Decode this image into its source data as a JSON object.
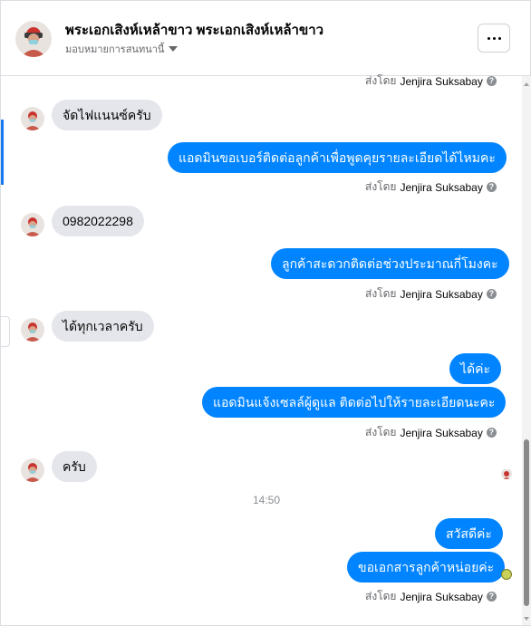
{
  "header": {
    "title": "พระเอกเสิงห์เหล้าขาว พระเอกเสิงห์เหล้าขาว",
    "subtitle": "มอบหมายการสนทนานี้",
    "more_icon": "more-icon"
  },
  "messages": [
    {
      "from": "them",
      "text": "จัดไฟแนนซ์ครับ"
    },
    {
      "from": "page",
      "text": "แอดมินขอเบอร์ติดต่อลูกค้าเพื่อพูดคุยรายละเอียดได้ไหมคะ",
      "sent_by": "ส่งโดย",
      "sender": "Jenjira Suksabay"
    },
    {
      "from": "them",
      "text": "0982022298"
    },
    {
      "from": "page",
      "text": "ลูกค้าสะดวกติดต่อช่วงประมาณกี่โมงคะ",
      "sent_by": "ส่งโดย",
      "sender": "Jenjira Suksabay"
    },
    {
      "from": "them",
      "text": "ได้ทุกเวลาครับ"
    },
    {
      "from": "page",
      "text": "ได้ค่ะ"
    },
    {
      "from": "page",
      "text": "แอดมินแจ้งเซลล์ผู้ดูแล ติดต่อไปให้รายละเอียดนะคะ",
      "sent_by": "ส่งโดย",
      "sender": "Jenjira Suksabay"
    },
    {
      "from": "them",
      "text": "ครับ"
    },
    {
      "from": "page",
      "text": "สวัสดีค่ะ"
    },
    {
      "from": "page",
      "text": "ขอเอกสารลูกค้าหน่อยค่ะ",
      "sent_by": "ส่งโดย",
      "sender": "Jenjira Suksabay"
    }
  ],
  "top_meta": {
    "sent_by": "ส่งโดย",
    "sender": "Jenjira Suksabay"
  },
  "timestamp": "14:50",
  "colors": {
    "outgoing": "#0084ff",
    "incoming": "#e4e6eb",
    "accent": "#1877f2"
  }
}
